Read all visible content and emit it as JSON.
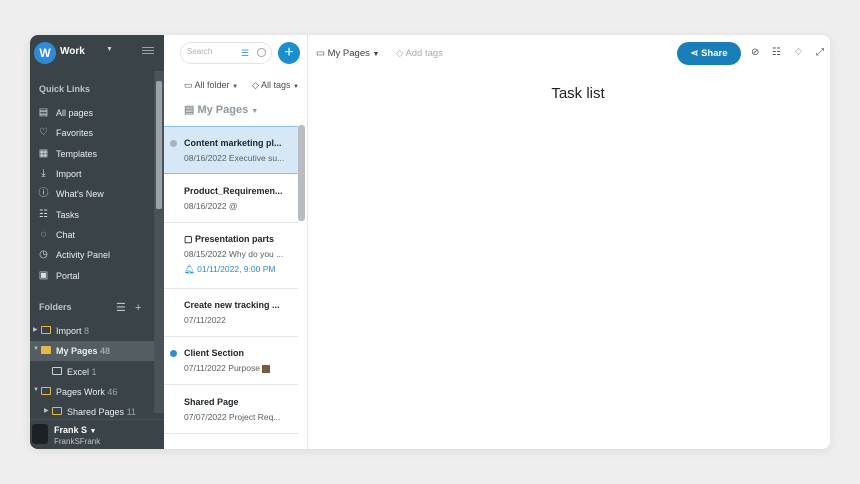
{
  "workspace": {
    "initial": "W",
    "name": "Work"
  },
  "sidebar": {
    "quick_links_label": "Quick Links",
    "items": [
      {
        "label": "All pages",
        "icon": "page-icon"
      },
      {
        "label": "Favorites",
        "icon": "heart-icon"
      },
      {
        "label": "Templates",
        "icon": "templates-icon"
      },
      {
        "label": "Import",
        "icon": "import-icon"
      },
      {
        "label": "What's New",
        "icon": "info-icon"
      },
      {
        "label": "Tasks",
        "icon": "tasks-icon"
      },
      {
        "label": "Chat",
        "icon": "chat-icon"
      },
      {
        "label": "Activity Panel",
        "icon": "clock-icon"
      },
      {
        "label": "Portal",
        "icon": "portal-icon"
      }
    ],
    "folders_label": "Folders",
    "folders": [
      {
        "name": "Import",
        "count": "8"
      },
      {
        "name": "My Pages",
        "count": "48"
      },
      {
        "name": "Excel",
        "count": "1"
      },
      {
        "name": "Pages Work",
        "count": "46"
      },
      {
        "name": "Shared Pages",
        "count": "11"
      }
    ],
    "user": {
      "name": "Frank S",
      "handle": "FrankSFrank"
    }
  },
  "list": {
    "search_placeholder": "Search",
    "filter_folder": "All folder",
    "filter_tags": "All tags",
    "heading": "My Pages",
    "pages": [
      {
        "title": "Content marketing pl...",
        "subtitle": "08/16/2022  Executive su...",
        "dot": "#a8b3b8"
      },
      {
        "title": "Product_Requiremen...",
        "subtitle": "08/16/2022  @"
      },
      {
        "title": "Presentation parts",
        "subtitle": "08/15/2022  Why do you ...",
        "reminder": "01/11/2022, 9:00 PM"
      },
      {
        "title": "Create new tracking ...",
        "subtitle": "07/11/2022"
      },
      {
        "title": "Client Section",
        "subtitle": "07/11/2022  Purpose",
        "dot": "#2f8ad8"
      },
      {
        "title": "Shared Page",
        "subtitle": "07/07/2022  Project Req..."
      }
    ]
  },
  "main": {
    "breadcrumb": "My Pages",
    "add_tags": "Add tags",
    "share_label": "Share",
    "title": "Task list"
  },
  "colors": {
    "sidebar_bg": "#3a4448",
    "accent": "#1a7fb9",
    "selected_row": "#d6e8f6"
  }
}
